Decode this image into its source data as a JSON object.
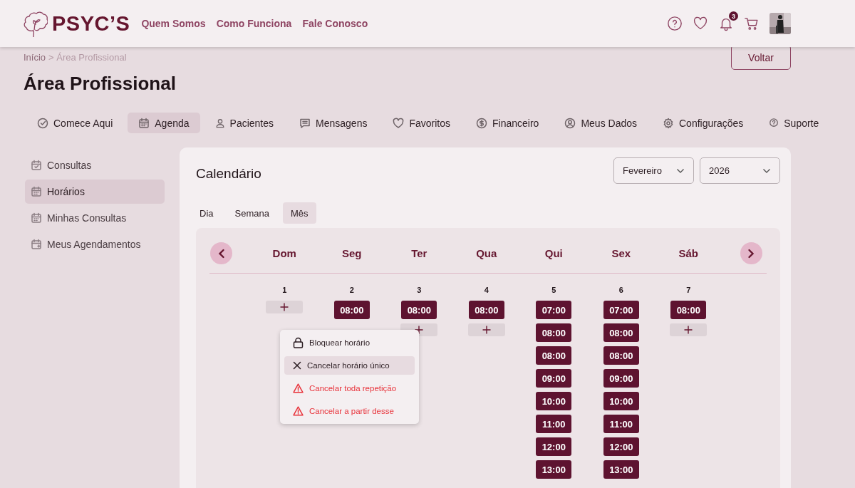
{
  "header": {
    "brand": "PSYC’S",
    "links": [
      "Quem Somos",
      "Como Funciona",
      "Fale Conosco"
    ],
    "notification_count": "3"
  },
  "breadcrumb": {
    "home": "Início",
    "current": "> Área Profissional"
  },
  "back_button": "Voltar",
  "title": "Área Profissional",
  "tabs": [
    {
      "label": "Comece Aqui",
      "selected": false
    },
    {
      "label": "Agenda",
      "selected": true
    },
    {
      "label": "Pacientes",
      "selected": false
    },
    {
      "label": "Mensagens",
      "selected": false
    },
    {
      "label": "Favoritos",
      "selected": false
    },
    {
      "label": "Financeiro",
      "selected": false
    },
    {
      "label": "Meus Dados",
      "selected": false
    },
    {
      "label": "Configurações",
      "selected": false
    },
    {
      "label": "Suporte",
      "selected": false
    }
  ],
  "sidebar": {
    "items": [
      {
        "label": "Consultas",
        "selected": false
      },
      {
        "label": "Horários",
        "selected": true
      },
      {
        "label": "Minhas Consultas",
        "selected": false
      },
      {
        "label": "Meus Agendamentos",
        "selected": false
      }
    ]
  },
  "calendar": {
    "title": "Calendário",
    "month": "Fevereiro",
    "year": "2026",
    "views": [
      {
        "label": "Dia",
        "selected": false
      },
      {
        "label": "Semana",
        "selected": false
      },
      {
        "label": "Mês",
        "selected": true
      }
    ],
    "weekdays": [
      "Dom",
      "Seg",
      "Ter",
      "Qua",
      "Qui",
      "Sex",
      "Sáb"
    ],
    "days": [
      {
        "number": "1",
        "add_button": true
      },
      {
        "number": "2",
        "slots": [
          "08:00"
        ],
        "add_button": false
      },
      {
        "number": "3",
        "slots": [
          "08:00"
        ],
        "add_button": true
      },
      {
        "number": "4",
        "slots": [
          "08:00"
        ],
        "add_button": true
      },
      {
        "number": "5",
        "slots": [
          "07:00",
          "08:00",
          "08:00",
          "09:00",
          "10:00",
          "11:00",
          "12:00",
          "13:00"
        ],
        "add_button": false
      },
      {
        "number": "6",
        "slots": [
          "07:00",
          "08:00",
          "08:00",
          "09:00",
          "10:00",
          "11:00",
          "12:00",
          "13:00"
        ],
        "add_button": false
      },
      {
        "number": "7",
        "slots": [
          "08:00"
        ],
        "add_button": true
      }
    ],
    "menu": {
      "items": [
        {
          "label": "Bloquear horário",
          "kind": "normal",
          "selected": false
        },
        {
          "label": "Cancelar horário único",
          "kind": "normal",
          "selected": true
        },
        {
          "label": "Cancelar toda repetição",
          "kind": "danger",
          "selected": false
        },
        {
          "label": "Cancelar a partir desse",
          "kind": "danger",
          "selected": false
        }
      ]
    }
  }
}
